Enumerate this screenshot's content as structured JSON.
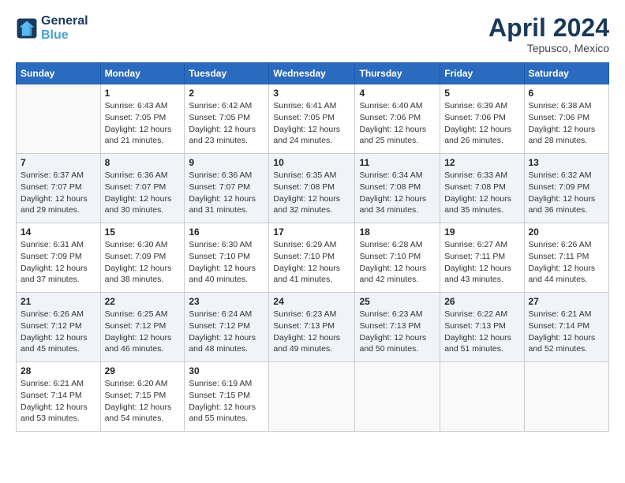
{
  "header": {
    "logo_line1": "General",
    "logo_line2": "Blue",
    "title": "April 2024",
    "subtitle": "Tepusco, Mexico"
  },
  "weekdays": [
    "Sunday",
    "Monday",
    "Tuesday",
    "Wednesday",
    "Thursday",
    "Friday",
    "Saturday"
  ],
  "weeks": [
    [
      {
        "day": "",
        "sunrise": "",
        "sunset": "",
        "daylight": ""
      },
      {
        "day": "1",
        "sunrise": "Sunrise: 6:43 AM",
        "sunset": "Sunset: 7:05 PM",
        "daylight": "Daylight: 12 hours and 21 minutes."
      },
      {
        "day": "2",
        "sunrise": "Sunrise: 6:42 AM",
        "sunset": "Sunset: 7:05 PM",
        "daylight": "Daylight: 12 hours and 23 minutes."
      },
      {
        "day": "3",
        "sunrise": "Sunrise: 6:41 AM",
        "sunset": "Sunset: 7:05 PM",
        "daylight": "Daylight: 12 hours and 24 minutes."
      },
      {
        "day": "4",
        "sunrise": "Sunrise: 6:40 AM",
        "sunset": "Sunset: 7:06 PM",
        "daylight": "Daylight: 12 hours and 25 minutes."
      },
      {
        "day": "5",
        "sunrise": "Sunrise: 6:39 AM",
        "sunset": "Sunset: 7:06 PM",
        "daylight": "Daylight: 12 hours and 26 minutes."
      },
      {
        "day": "6",
        "sunrise": "Sunrise: 6:38 AM",
        "sunset": "Sunset: 7:06 PM",
        "daylight": "Daylight: 12 hours and 28 minutes."
      }
    ],
    [
      {
        "day": "7",
        "sunrise": "Sunrise: 6:37 AM",
        "sunset": "Sunset: 7:07 PM",
        "daylight": "Daylight: 12 hours and 29 minutes."
      },
      {
        "day": "8",
        "sunrise": "Sunrise: 6:36 AM",
        "sunset": "Sunset: 7:07 PM",
        "daylight": "Daylight: 12 hours and 30 minutes."
      },
      {
        "day": "9",
        "sunrise": "Sunrise: 6:36 AM",
        "sunset": "Sunset: 7:07 PM",
        "daylight": "Daylight: 12 hours and 31 minutes."
      },
      {
        "day": "10",
        "sunrise": "Sunrise: 6:35 AM",
        "sunset": "Sunset: 7:08 PM",
        "daylight": "Daylight: 12 hours and 32 minutes."
      },
      {
        "day": "11",
        "sunrise": "Sunrise: 6:34 AM",
        "sunset": "Sunset: 7:08 PM",
        "daylight": "Daylight: 12 hours and 34 minutes."
      },
      {
        "day": "12",
        "sunrise": "Sunrise: 6:33 AM",
        "sunset": "Sunset: 7:08 PM",
        "daylight": "Daylight: 12 hours and 35 minutes."
      },
      {
        "day": "13",
        "sunrise": "Sunrise: 6:32 AM",
        "sunset": "Sunset: 7:09 PM",
        "daylight": "Daylight: 12 hours and 36 minutes."
      }
    ],
    [
      {
        "day": "14",
        "sunrise": "Sunrise: 6:31 AM",
        "sunset": "Sunset: 7:09 PM",
        "daylight": "Daylight: 12 hours and 37 minutes."
      },
      {
        "day": "15",
        "sunrise": "Sunrise: 6:30 AM",
        "sunset": "Sunset: 7:09 PM",
        "daylight": "Daylight: 12 hours and 38 minutes."
      },
      {
        "day": "16",
        "sunrise": "Sunrise: 6:30 AM",
        "sunset": "Sunset: 7:10 PM",
        "daylight": "Daylight: 12 hours and 40 minutes."
      },
      {
        "day": "17",
        "sunrise": "Sunrise: 6:29 AM",
        "sunset": "Sunset: 7:10 PM",
        "daylight": "Daylight: 12 hours and 41 minutes."
      },
      {
        "day": "18",
        "sunrise": "Sunrise: 6:28 AM",
        "sunset": "Sunset: 7:10 PM",
        "daylight": "Daylight: 12 hours and 42 minutes."
      },
      {
        "day": "19",
        "sunrise": "Sunrise: 6:27 AM",
        "sunset": "Sunset: 7:11 PM",
        "daylight": "Daylight: 12 hours and 43 minutes."
      },
      {
        "day": "20",
        "sunrise": "Sunrise: 6:26 AM",
        "sunset": "Sunset: 7:11 PM",
        "daylight": "Daylight: 12 hours and 44 minutes."
      }
    ],
    [
      {
        "day": "21",
        "sunrise": "Sunrise: 6:26 AM",
        "sunset": "Sunset: 7:12 PM",
        "daylight": "Daylight: 12 hours and 45 minutes."
      },
      {
        "day": "22",
        "sunrise": "Sunrise: 6:25 AM",
        "sunset": "Sunset: 7:12 PM",
        "daylight": "Daylight: 12 hours and 46 minutes."
      },
      {
        "day": "23",
        "sunrise": "Sunrise: 6:24 AM",
        "sunset": "Sunset: 7:12 PM",
        "daylight": "Daylight: 12 hours and 48 minutes."
      },
      {
        "day": "24",
        "sunrise": "Sunrise: 6:23 AM",
        "sunset": "Sunset: 7:13 PM",
        "daylight": "Daylight: 12 hours and 49 minutes."
      },
      {
        "day": "25",
        "sunrise": "Sunrise: 6:23 AM",
        "sunset": "Sunset: 7:13 PM",
        "daylight": "Daylight: 12 hours and 50 minutes."
      },
      {
        "day": "26",
        "sunrise": "Sunrise: 6:22 AM",
        "sunset": "Sunset: 7:13 PM",
        "daylight": "Daylight: 12 hours and 51 minutes."
      },
      {
        "day": "27",
        "sunrise": "Sunrise: 6:21 AM",
        "sunset": "Sunset: 7:14 PM",
        "daylight": "Daylight: 12 hours and 52 minutes."
      }
    ],
    [
      {
        "day": "28",
        "sunrise": "Sunrise: 6:21 AM",
        "sunset": "Sunset: 7:14 PM",
        "daylight": "Daylight: 12 hours and 53 minutes."
      },
      {
        "day": "29",
        "sunrise": "Sunrise: 6:20 AM",
        "sunset": "Sunset: 7:15 PM",
        "daylight": "Daylight: 12 hours and 54 minutes."
      },
      {
        "day": "30",
        "sunrise": "Sunrise: 6:19 AM",
        "sunset": "Sunset: 7:15 PM",
        "daylight": "Daylight: 12 hours and 55 minutes."
      },
      {
        "day": "",
        "sunrise": "",
        "sunset": "",
        "daylight": ""
      },
      {
        "day": "",
        "sunrise": "",
        "sunset": "",
        "daylight": ""
      },
      {
        "day": "",
        "sunrise": "",
        "sunset": "",
        "daylight": ""
      },
      {
        "day": "",
        "sunrise": "",
        "sunset": "",
        "daylight": ""
      }
    ]
  ]
}
